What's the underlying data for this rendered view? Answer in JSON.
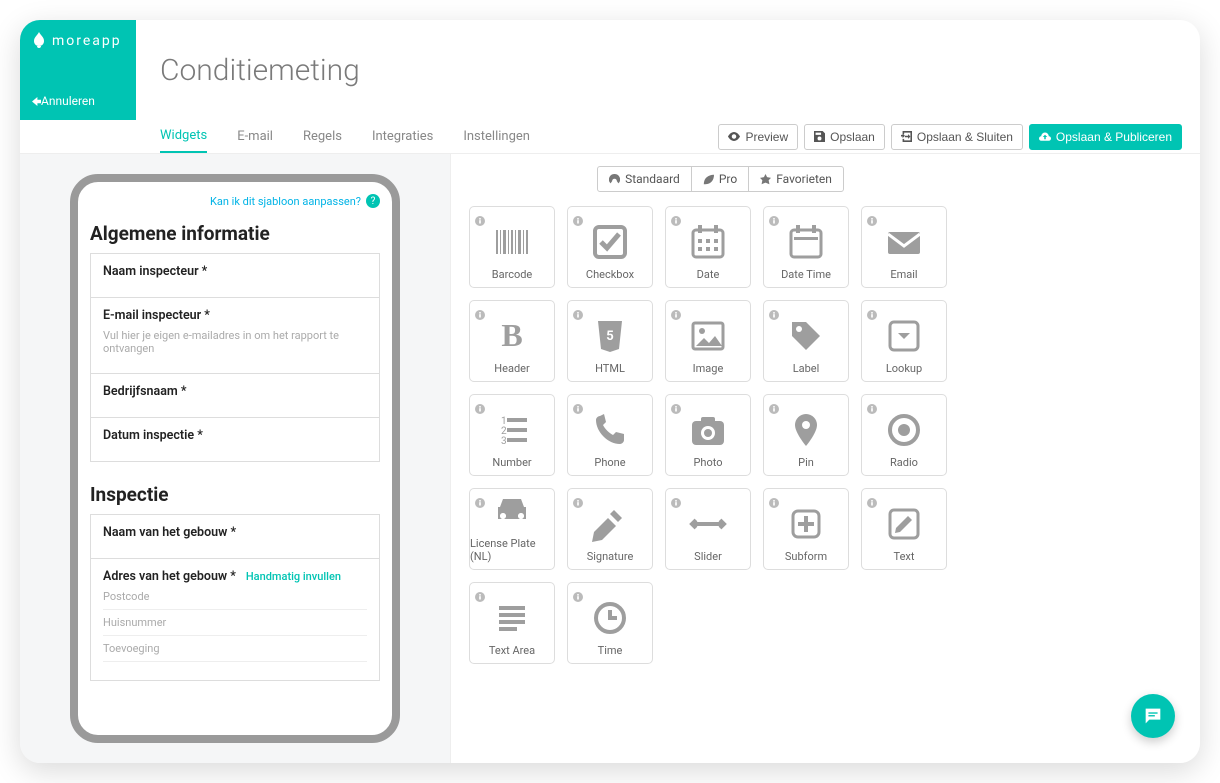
{
  "brand": "moreapp",
  "cancel": "Annuleren",
  "title": "Conditiemeting",
  "tabs": [
    "Widgets",
    "E-mail",
    "Regels",
    "Integraties",
    "Instellingen"
  ],
  "activeTab": 0,
  "actions": {
    "preview": "Preview",
    "save": "Opslaan",
    "saveClose": "Opslaan & Sluiten",
    "savePublish": "Opslaan & Publiceren"
  },
  "templateLink": "Kan ik dit sjabloon aanpassen?",
  "form": {
    "section1": "Algemene informatie",
    "fields1": [
      {
        "label": "Naam inspecteur *"
      },
      {
        "label": "E-mail inspecteur *",
        "hint": "Vul hier je eigen e-mailadres in om het rapport te ontvangen"
      },
      {
        "label": "Bedrijfsnaam *"
      },
      {
        "label": "Datum inspectie *"
      }
    ],
    "section2": "Inspectie",
    "fields2a": {
      "label": "Naam van het gebouw *"
    },
    "addr": {
      "label": "Adres van het gebouw *",
      "link": "Handmatig invullen",
      "subs": [
        "Postcode",
        "Huisnummer",
        "Toevoeging"
      ]
    }
  },
  "viewTabs": [
    "Standaard",
    "Pro",
    "Favorieten"
  ],
  "widgets": [
    "Barcode",
    "Checkbox",
    "Date",
    "Date Time",
    "Email",
    "Header",
    "HTML",
    "Image",
    "Label",
    "Lookup",
    "Number",
    "Phone",
    "Photo",
    "Pin",
    "Radio",
    "License Plate (NL)",
    "Signature",
    "Slider",
    "Subform",
    "Text",
    "Text Area",
    "Time"
  ]
}
